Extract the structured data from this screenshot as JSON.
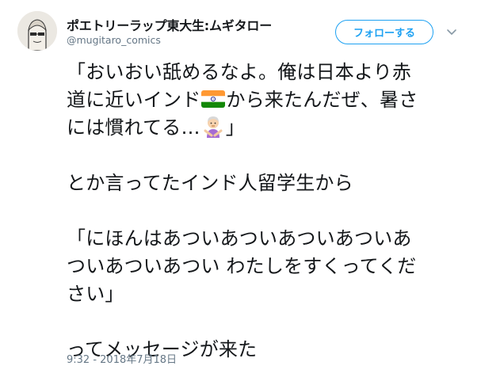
{
  "author": {
    "display_name": "ポエトリーラップ東大生:ムギタロー",
    "handle": "@mugitaro_comics"
  },
  "actions": {
    "follow_label": "フォローする"
  },
  "tweet": {
    "lines": [
      "「おいおい舐めるなよ。俺は日本より赤",
      "道に近いインド",
      "から来たんだぜ、暑さ",
      "には慣れてる…",
      "」",
      "とか言ってたインド人留学生から",
      "「にほんはあついあついあついあついあ",
      "ついあついあつい わたしをすくってくだ",
      "さい」",
      "ってメッセージが来た"
    ],
    "emoji": [
      "india-flag",
      "person-gesturing-no"
    ]
  },
  "timestamp": "9:32 - 2018年7月18日",
  "colors": {
    "accent": "#1da1f2",
    "text": "#14171a",
    "secondary": "#657786"
  }
}
